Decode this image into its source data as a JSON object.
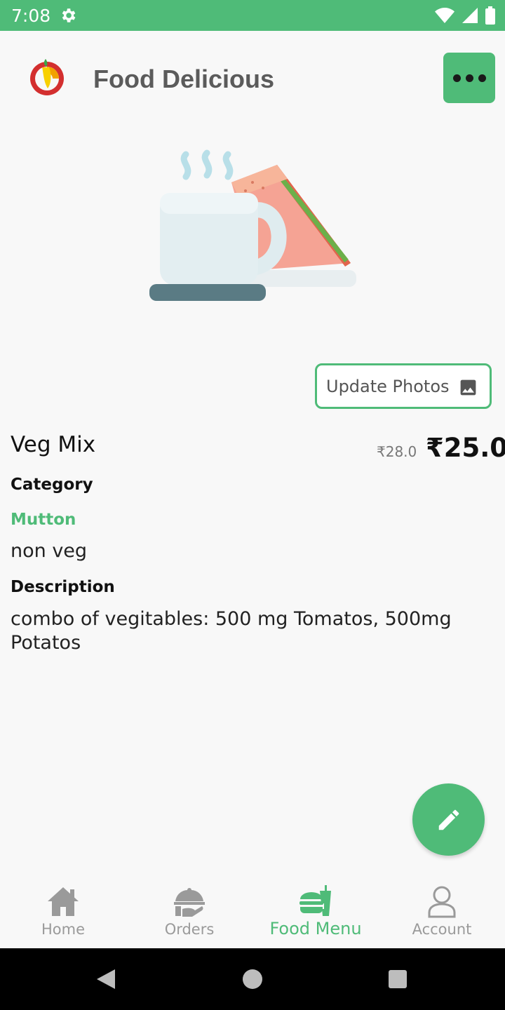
{
  "status_bar": {
    "time": "7:08",
    "icons": [
      "gear-icon",
      "wifi-icon",
      "signal-icon",
      "battery-icon"
    ]
  },
  "header": {
    "title": "Food Delicious",
    "more_icon": "more-horizontal-icon"
  },
  "product": {
    "image_icon": "coffee-sandwich-illustration",
    "update_photos_label": "Update Photos",
    "name": "Veg Mix",
    "old_price": "₹28.0",
    "price": "₹25.0",
    "category_heading": "Category",
    "category": "Mutton",
    "type": "non veg",
    "description_heading": "Description",
    "description": "combo of vegitables: 500 mg Tomatos, 500mg Potatos"
  },
  "bottom_nav": {
    "items": [
      {
        "label": "Home",
        "icon": "home-icon",
        "active": false
      },
      {
        "label": "Orders",
        "icon": "orders-icon",
        "active": false
      },
      {
        "label": "Food Menu",
        "icon": "food-menu-icon",
        "active": true
      },
      {
        "label": "Account",
        "icon": "account-icon",
        "active": false
      }
    ]
  },
  "colors": {
    "accent": "#4fbb78",
    "title_gray": "#5b5b5b",
    "inactive_nav": "#9a9a9a"
  }
}
